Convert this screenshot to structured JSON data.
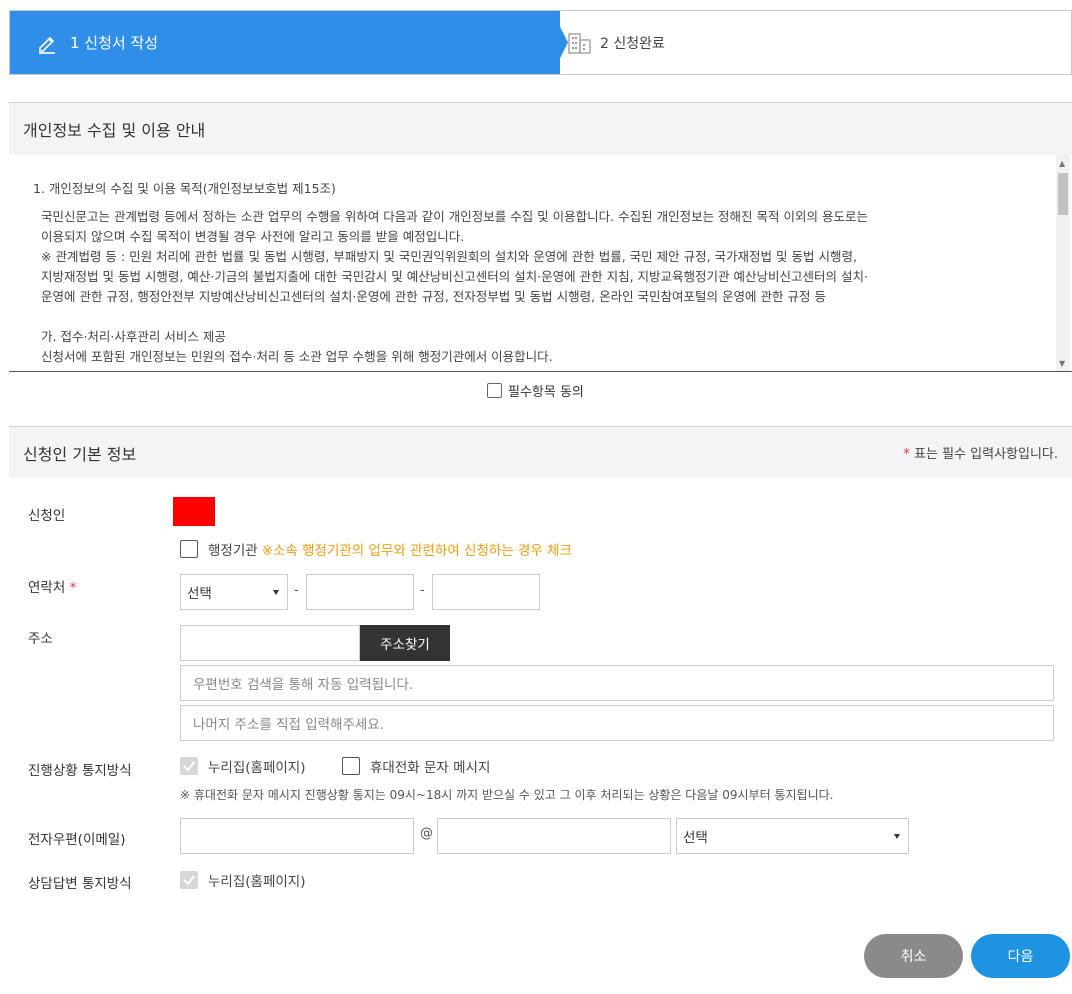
{
  "steps": {
    "step1": "1 신청서 작성",
    "step2": "2 신청완료"
  },
  "privacy": {
    "title": "개인정보 수집 및 이용 안내",
    "heading": "1. 개인정보의 수집 및 이용 목적(개인정보보호법 제15조)",
    "para1_line1": "국민신문고는 관계법령 등에서 정하는 소관 업무의 수행을 위하여 다음과 같이 개인정보를 수집 및 이용합니다. 수집된 개인정보는 정해진 목적 이외의 용도로는",
    "para1_line2": "이용되지 않으며 수집 목적이 변경될 경우 사전에 알리고 동의를 받을 예정입니다.",
    "para2_line1": "※ 관계법령 등 : 민원 처리에 관한 법률 및 동법 시행령, 부패방지 및 국민권익위원회의 설치와 운영에 관한 법률, 국민 제안 규정, 국가재정법 및 동법 시행령,",
    "para2_line2": "지방재정법 및 동법 시행령, 예산·기금의 불법지출에 대한 국민감시 및 예산낭비신고센터의 설치·운영에 관한 지침, 지방교육행정기관 예산낭비신고센터의 설치·",
    "para2_line3": "운영에 관한 규정, 행정안전부 지방예산낭비신고센터의 설치·운영에 관한 규정, 전자정부법 및 동법 시행령, 온라인 국민참여포털의 운영에 관한 규정 등",
    "sub_heading": "가. 접수·처리·사후관리 서비스 제공",
    "sub_line1": "신청서에 포함된 개인정보는 민원의 접수·처리 등 소관 업무 수행을 위해 행정기관에서 이용합니다."
  },
  "agree_label": "필수항목 동의",
  "basic": {
    "title": "신청인 기본 정보",
    "required_star": "*",
    "required_note": " 표는 필수 입력사항입니다.",
    "applicant_label": "신청인",
    "admin_label": "행정기관",
    "admin_note": "※소속 행정기관의 업무와 관련하여 신청하는 경우 체크",
    "contact_label": "연락처",
    "contact_star": "*",
    "contact_select": "선택",
    "dash": "-",
    "address_label": "주소",
    "address_button": "주소찾기",
    "address_ph1": "우편번호 검색을 통해 자동 입력됩니다.",
    "address_ph2": "나머지 주소를 직접 입력해주세요.",
    "notify_label": "진행상황 통지방식",
    "notify_opt1": "누리집(홈페이지)",
    "notify_opt2": "휴대전화 문자 메시지",
    "notify_notice": "※ 휴대전화 문자 메시지 진행상황 통지는 09시~18시 까지 받으실 수 있고 그 이후 처리되는 상황은 다음날 09시부터 통지됩니다.",
    "email_label": "전자우편(이메일)",
    "email_at": "@",
    "email_select": "선택",
    "answer_label": "상담답변 통지방식",
    "answer_opt1": "누리집(홈페이지)"
  },
  "buttons": {
    "cancel": "취소",
    "next": "다음"
  },
  "colors": {
    "primary": "#2f8fe8",
    "dark_button": "#333333",
    "cancel": "#8a8a8a",
    "next": "#1e93e0",
    "accent_orange": "#f39c12",
    "red_box": "#ff0000"
  }
}
